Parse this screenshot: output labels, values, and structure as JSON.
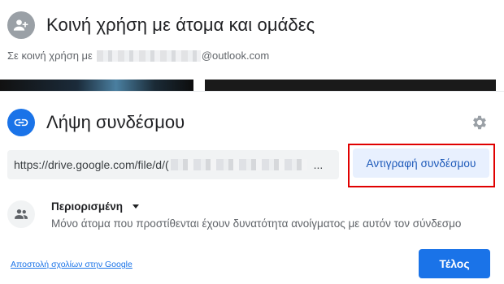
{
  "share": {
    "title": "Κοινή χρήση με άτομα και ομάδες",
    "shared_with_prefix": "Σε κοινή χρήση με",
    "email_suffix": "@outlook.com",
    "icon": "person-add-icon"
  },
  "link": {
    "title": "Λήψη συνδέσμου",
    "icon": "link-icon",
    "settings_icon": "gear-icon",
    "url_prefix": "https://drive.google.com/file/d/(",
    "url_ellipsis": "...",
    "copy_label": "Αντιγραφή συνδέσμου"
  },
  "access": {
    "icon": "people-icon",
    "level": "Περιορισμένη",
    "description": "Μόνο άτομα που προστίθενται έχουν δυνατότητα ανοίγματος με αυτόν τον σύνδεσμο"
  },
  "footer": {
    "feedback_label": "Αποστολή σχολίων στην Google",
    "done_label": "Τέλος"
  },
  "colors": {
    "accent": "#1a73e8",
    "copy_button_bg": "#e8f0fe",
    "highlight": "#e00000"
  }
}
